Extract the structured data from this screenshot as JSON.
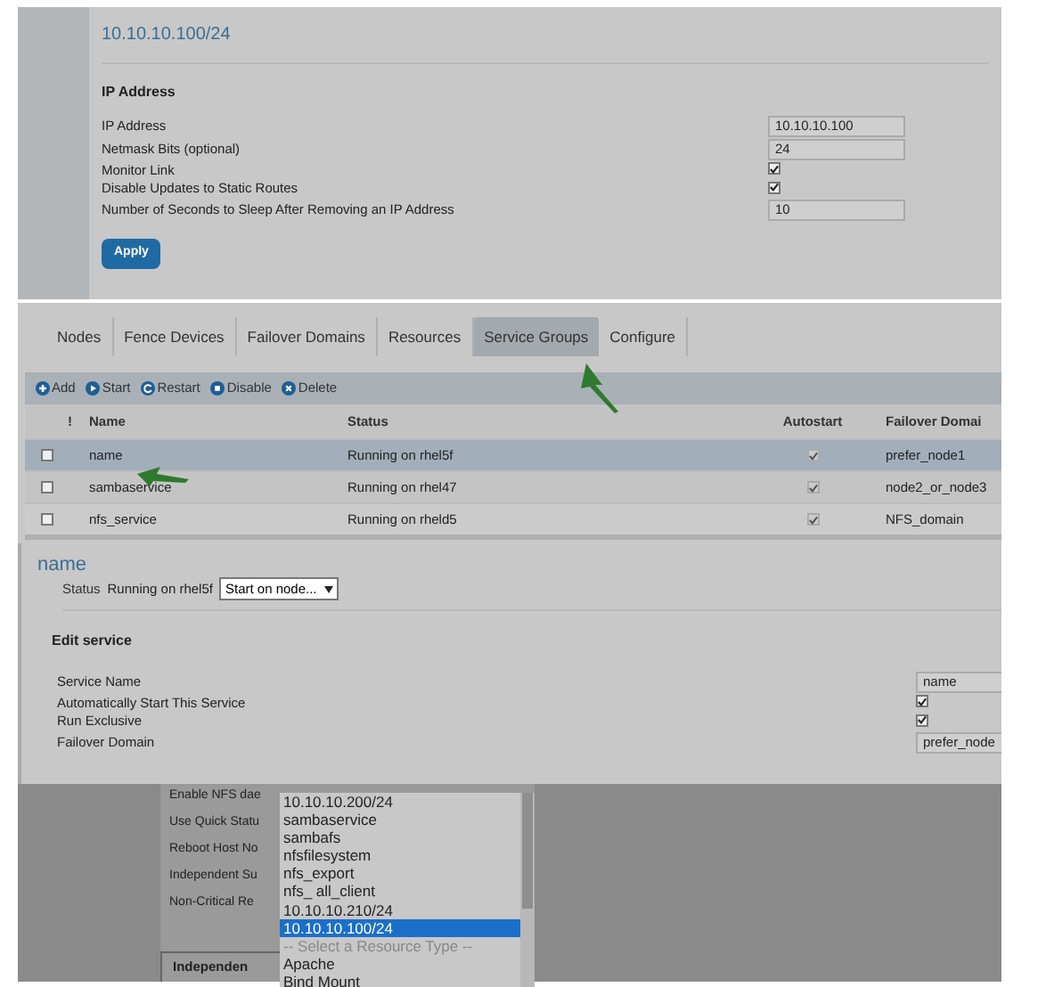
{
  "ip_panel": {
    "title": "10.10.10.100/24",
    "heading": "IP Address",
    "fields": [
      {
        "kind": "text",
        "label": "IP Address",
        "value": "10.10.10.100"
      },
      {
        "kind": "text",
        "label": "Netmask Bits (optional)",
        "value": "24"
      },
      {
        "kind": "checkbox",
        "label": "Monitor Link",
        "checked": true
      },
      {
        "kind": "checkbox",
        "label": "Disable Updates to Static Routes",
        "checked": true
      },
      {
        "kind": "text",
        "label": "Number of Seconds to Sleep After Removing an IP Address",
        "value": "10"
      }
    ],
    "apply_button": "Apply"
  },
  "tabs": [
    {
      "label": "Nodes",
      "selected": false
    },
    {
      "label": "Fence Devices",
      "selected": false
    },
    {
      "label": "Failover Domains",
      "selected": false
    },
    {
      "label": "Resources",
      "selected": false
    },
    {
      "label": "Service Groups",
      "selected": true
    },
    {
      "label": "Configure",
      "selected": false
    }
  ],
  "toolbar": [
    {
      "label": "Add",
      "kind": "add"
    },
    {
      "label": "Start",
      "kind": "start"
    },
    {
      "label": "Restart",
      "kind": "restart"
    },
    {
      "label": "Disable",
      "kind": "disable"
    },
    {
      "label": "Delete",
      "kind": "delete"
    }
  ],
  "table": {
    "columns": [
      "!",
      "Name",
      "Status",
      "Autostart",
      "Failover Domai"
    ],
    "rows": [
      {
        "checked": false,
        "name": "name",
        "status": "Running on rhel5f",
        "autostart": true,
        "failover_domain": "prefer_node1",
        "selected": true
      },
      {
        "checked": false,
        "name": "sambaservice",
        "status": "Running on rhel47",
        "autostart": true,
        "failover_domain": "node2_or_node3",
        "selected": false
      },
      {
        "checked": false,
        "name": "nfs_service",
        "status": "Running on rheld5",
        "autostart": true,
        "failover_domain": "NFS_domain",
        "selected": false
      }
    ]
  },
  "service": {
    "title": "name",
    "status_label": "Status",
    "status": "Running on rhel5f",
    "action_select": "Start on node...",
    "heading": "Edit service",
    "fields": [
      {
        "kind": "text",
        "label": "Service Name",
        "value": "name"
      },
      {
        "kind": "checkbox",
        "label": "Automatically Start This Service",
        "checked": true
      },
      {
        "kind": "checkbox",
        "label": "Run Exclusive",
        "checked": true
      },
      {
        "kind": "text",
        "label": "Failover Domain",
        "value": "prefer_node"
      }
    ]
  },
  "resource_form": {
    "labels": [
      "Enable NFS dae",
      "Use Quick Statu",
      "Reboot Host No",
      "Independent Su",
      "Non-Critical Re"
    ],
    "legend": "Independen"
  },
  "resource_list": {
    "items": [
      {
        "kind": "option",
        "label": "10.10.10.200/24",
        "selected": false
      },
      {
        "kind": "option",
        "label": "sambaservice",
        "selected": false
      },
      {
        "kind": "option",
        "label": "sambafs",
        "selected": false
      },
      {
        "kind": "option",
        "label": "nfsfilesystem",
        "selected": false
      },
      {
        "kind": "option",
        "label": "nfs_export",
        "selected": false
      },
      {
        "kind": "option",
        "label": "nfs_ all_client",
        "selected": false
      },
      {
        "kind": "option",
        "label": "10.10.10.210/24",
        "selected": false
      },
      {
        "kind": "option",
        "label": "10.10.10.100/24",
        "selected": true
      },
      {
        "kind": "placeholder",
        "label": "-- Select a Resource Type --",
        "selected": false
      },
      {
        "kind": "option",
        "label": "Apache",
        "selected": false
      },
      {
        "kind": "option",
        "label": "Bind Mount",
        "selected": false
      }
    ]
  }
}
